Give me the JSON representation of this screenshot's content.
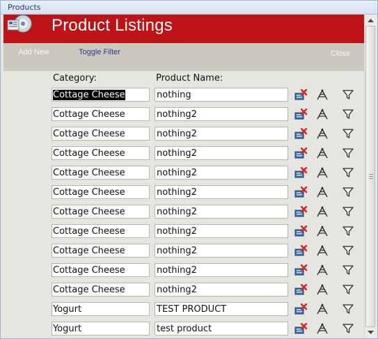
{
  "window": {
    "tab_title": "Products"
  },
  "header": {
    "title": "Product Listings"
  },
  "toolbar": {
    "add_new": "Add New",
    "toggle_filter": "Toggle Filter",
    "close": "Close"
  },
  "columns": {
    "category": "Category:",
    "product_name": "Product Name:"
  },
  "rows": [
    {
      "category": "Cottage Cheese",
      "product_name": "nothing",
      "category_selected": true
    },
    {
      "category": "Cottage Cheese",
      "product_name": "nothing2"
    },
    {
      "category": "Cottage Cheese",
      "product_name": "nothing2"
    },
    {
      "category": "Cottage Cheese",
      "product_name": "nothing2"
    },
    {
      "category": "Cottage Cheese",
      "product_name": "nothing2"
    },
    {
      "category": "Cottage Cheese",
      "product_name": "nothing2"
    },
    {
      "category": "Cottage Cheese",
      "product_name": "nothing2"
    },
    {
      "category": "Cottage Cheese",
      "product_name": "nothing2"
    },
    {
      "category": "Cottage Cheese",
      "product_name": "nothing2"
    },
    {
      "category": "Cottage Cheese",
      "product_name": "nothing2"
    },
    {
      "category": "Cottage Cheese",
      "product_name": "nothing2"
    },
    {
      "category": "Yogurt",
      "product_name": "TEST PRODUCT"
    },
    {
      "category": "Yogurt",
      "product_name": "test product"
    }
  ],
  "row_icons": {
    "delete": "delete-record-icon",
    "edit": "edit-record-icon",
    "filter": "filter-icon"
  },
  "colors": {
    "header_bg": "#be1418",
    "toolbar_bg": "#cbc8bf",
    "body_bg": "#e6e6e1"
  }
}
